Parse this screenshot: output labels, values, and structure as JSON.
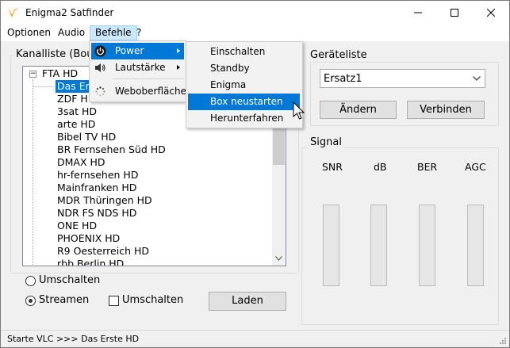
{
  "window": {
    "title": "Enigma2 Satfinder"
  },
  "menubar": {
    "items": [
      "Optionen",
      "Audio",
      "Befehle",
      "?"
    ]
  },
  "befehle_menu": {
    "items": [
      {
        "label": "Power",
        "icon": "power-icon",
        "submenu": true,
        "highlighted": true
      },
      {
        "label": "Lautstärke",
        "icon": "speaker-icon",
        "submenu": true
      },
      {
        "label": "Weboberfläche",
        "icon": "loading-icon",
        "submenu": false
      }
    ]
  },
  "power_submenu": {
    "items": [
      {
        "label": "Einschalten"
      },
      {
        "label": "Standby"
      },
      {
        "label": "Enigma neustarten"
      },
      {
        "label": "Box neustarten",
        "highlighted": true
      },
      {
        "label": "Herunterfahren"
      }
    ]
  },
  "channels": {
    "group_title": "Kanalliste (Bou",
    "folder": "FTA HD",
    "items": [
      "Das Er",
      "ZDF HD",
      "3sat HD",
      "arte HD",
      "Bibel TV HD",
      "BR Fernsehen Süd HD",
      "DMAX HD",
      "hr-fernsehen HD",
      "Mainfranken HD",
      "MDR Thüringen HD",
      "NDR FS NDS HD",
      "ONE HD",
      "PHOENIX HD",
      "R9 Oesterreich HD",
      "rbb Berlin HD"
    ],
    "selected": "Das Er"
  },
  "controls": {
    "radio_umschalten": "Umschalten",
    "radio_streamen": "Streamen",
    "checkbox_umschalten": "Umschalten",
    "load_button": "Laden"
  },
  "devices": {
    "group_title": "Geräteliste",
    "selected": "Ersatz1",
    "change_button": "Ändern",
    "connect_button": "Verbinden"
  },
  "signal": {
    "group_title": "Signal",
    "labels": [
      "SNR",
      "dB",
      "BER",
      "AGC"
    ]
  },
  "status": {
    "text": "Starte VLC >>> Das Erste HD"
  },
  "colors": {
    "highlight": "#0078d7",
    "menu_active": "#cce8ff"
  }
}
